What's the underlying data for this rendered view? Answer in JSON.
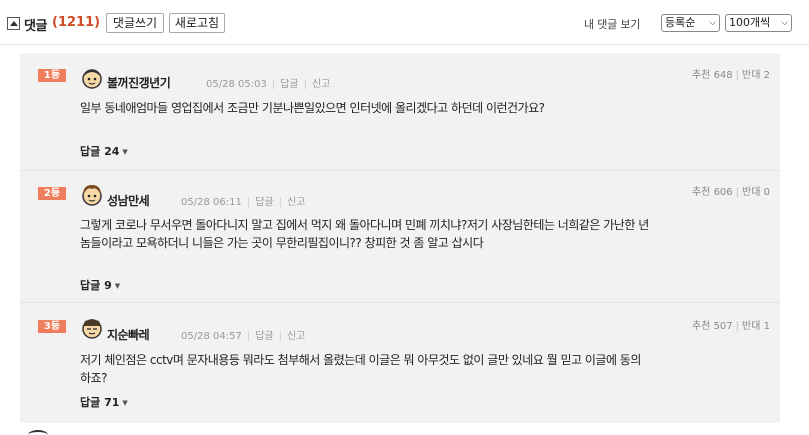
{
  "header": {
    "title": "댓글",
    "count": "(1211)",
    "write_button": "댓글쓰기",
    "refresh_button": "새로고침",
    "my_comments": "내 댓글 보기",
    "sort_select": "등록순",
    "page_size_select": "100개씩"
  },
  "labels": {
    "reply": "답글",
    "report": "신고",
    "upvote": "추천",
    "downvote": "반대"
  },
  "comments": [
    {
      "rank": "1등",
      "nickname": "볼꺼진갱년기",
      "date": "05/28 05:03",
      "up": "648",
      "down": "2",
      "text": "일부 동네애엄마들 영업집에서 조금만 기분나쁜일있으면 인터넷에 올리겠다고 하던데 이런건가요?",
      "reply_count": "24"
    },
    {
      "rank": "2등",
      "nickname": "성남만세",
      "date": "05/28 06:11",
      "up": "606",
      "down": "0",
      "text": "그렇게 코로나 무서우면 돌아다니지 말고 집에서 먹지 왜 돌아다니며 민폐 끼치냐?저기 사장님한테는 너희같은 가난한 년놈들이라고 모욕하더니 니들은 가는 곳이 무한리필집이니?? 창피한 것 좀 알고 삽시다",
      "reply_count": "9"
    },
    {
      "rank": "3등",
      "nickname": "지순빠레",
      "date": "05/28 04:57",
      "up": "507",
      "down": "1",
      "text": "저기 체인점은 cctv며 문자내용등 뭐라도 첨부해서 올렸는데 이글은 뭐 아무것도 없이 글만 있네요 뭘 믿고 이글에 동의하죠?",
      "reply_count": "71"
    }
  ],
  "colors": {
    "rank_badge": "#ef7f5c",
    "count": "#d14a26",
    "list_bg": "#f2f2f2"
  }
}
